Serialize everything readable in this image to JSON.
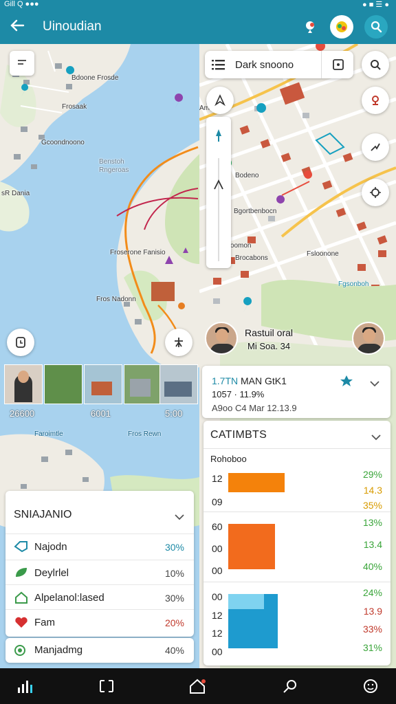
{
  "status_bar": {
    "left_text": "Gill Q ●●●",
    "right_text": "● ■ ☰ ●"
  },
  "app_bar": {
    "title": "Uinoudian",
    "icons": [
      "back-arrow-icon",
      "location-pin-icon",
      "map-layers-icon",
      "search-icon"
    ]
  },
  "search": {
    "value": "Dark snoono"
  },
  "map_labels_left": [
    "Bdoone Frosde",
    "Frosaak",
    "Gcoondnoono",
    "Benstoh",
    "Rngeroas",
    "sR Dania",
    "Froserone Fanisio",
    "Fros Nadonn",
    "Faroimtle",
    "Fros Rewn"
  ],
  "map_labels_right": [
    "Amo",
    "Bodeno",
    "Bgortbenbocn",
    "Bioomon",
    "Brocabons",
    "Fsloonone",
    "Fgsonboh"
  ],
  "poi": {
    "name": "Rastuil oral",
    "subtitle": "Mi Soa. 34"
  },
  "thumbnail_labels": [
    "26600",
    "6001",
    "5:00"
  ],
  "stats": {
    "title": "SNIAJANIO",
    "rows": [
      {
        "label": "Najodn",
        "value": "30%",
        "icon": "tag-icon",
        "color": "#1d8aa6"
      },
      {
        "label": "Deylrlel",
        "value": "10%",
        "icon": "leaf-icon",
        "color": "#444444"
      },
      {
        "label": "Alpelanol:lased",
        "value": "30%",
        "icon": "home-icon",
        "color": "#444444"
      },
      {
        "label": "Fam",
        "value": "20%",
        "icon": "heart-icon",
        "color": "#c0392b"
      }
    ],
    "extra": {
      "label": "Manjadmg",
      "value": "40%",
      "icon": "target-icon"
    }
  },
  "route": {
    "line1_highlight": "1.7TN",
    "line1_rest": "MAN GtK1",
    "line2": "1057 · 11.9%",
    "line3": "A9oo  C4 Mar 12.13.9"
  },
  "chart_card": {
    "title": "CATIMBTS",
    "subtitle": "Rohoboo",
    "chart_data": {
      "type": "bar",
      "groups": [
        {
          "ticks": [
            "12",
            "09"
          ],
          "right_values": [
            "29%",
            "14.3",
            "35%"
          ],
          "bar_color": "#f4820b",
          "value": 1.0
        },
        {
          "ticks": [
            "60",
            "00",
            "00"
          ],
          "right_values": [
            "13%",
            "13.4",
            "40%"
          ],
          "bar_color": "#f26b1d",
          "value": 0.85
        },
        {
          "ticks": [
            "00",
            "12",
            "12",
            "00"
          ],
          "right_values": [
            "24%",
            "13.9",
            "33%",
            "31%"
          ],
          "bar_color": "#1e9bcf",
          "value": 0.9
        }
      ],
      "right_value_colors": [
        "#3aa53a",
        "#d89b00",
        "#d89b00",
        "#3aa53a",
        "#3aa53a",
        "#3aa53a",
        "#3aa53a",
        "#c0392b",
        "#c0392b",
        "#3aa53a"
      ]
    }
  },
  "nav_bar": {
    "icons": [
      "signal-bars-icon",
      "recent-apps-icon",
      "home-icon",
      "search-icon",
      "face-icon"
    ]
  }
}
